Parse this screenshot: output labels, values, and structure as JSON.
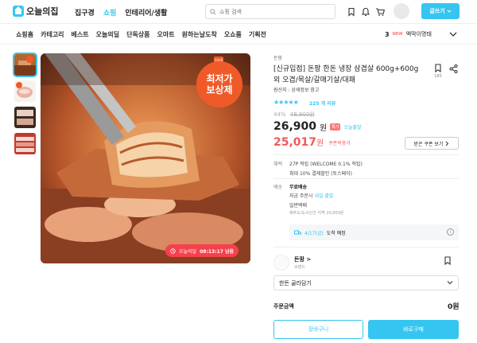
{
  "header": {
    "logo_text": "오늘의집",
    "nav": [
      "집구경",
      "쇼핑",
      "인테리어/생활"
    ],
    "search_placeholder": "쇼핑 검색",
    "write_label": "글쓰기"
  },
  "subnav": {
    "items": [
      "쇼핑홈",
      "카테고리",
      "베스트",
      "오늘의딜",
      "단독상품",
      "오마트",
      "원하는날도착",
      "오쇼룸",
      "기획전"
    ],
    "trend_rank": "3",
    "trend_new": "NEW",
    "trend_text": "액막이명태"
  },
  "hero": {
    "badge_line1": "최저가",
    "badge_line2": "보상제",
    "mini_tag": "오늘의딜",
    "timer_label": "오늘의딜",
    "timer_value": "08:13:17 남음"
  },
  "product": {
    "brand": "돈팡",
    "title": "[신규입점] 돈팡 한돈 냉장 삼겹살 600g+600g 외 오겹/목살/갈매기살/대패",
    "bookmark_count": "185",
    "origin": "원산지 : 상세정보 참고",
    "stars": "★★★★★",
    "review_count": "225 개 리뷰",
    "discount_pct": "44%",
    "original_price": "48,900원",
    "price": "26,900",
    "price_unit": "원",
    "special_badge": "특가",
    "best_price": "오늘출발",
    "coupon_price": "25,017",
    "coupon_unit": "원",
    "coupon_label": "쿠폰적용가",
    "coupon_button": "받은 쿠폰 보기"
  },
  "benefits": {
    "label": "혜택",
    "point": "27P 적립 (WELCOME 0.1% 적립)",
    "card": "최대 10% 결제할인 (토스페이)"
  },
  "shipping": {
    "label": "배송",
    "fee": "무료배송",
    "order_note_prefix": "지금 주문시",
    "order_note_hi": "내일 출발",
    "method": "일반택배",
    "extra": "제주도/도서산간 지역 20,000원",
    "arrival_date": "4/17(금)",
    "arrival_text": "도착 예정"
  },
  "brand_card": {
    "name": "돈팡 >",
    "sub": "브랜드"
  },
  "order": {
    "select_text": "한돈 골라담기",
    "total_label": "주문금액",
    "total_value": "0원",
    "cart_label": "장바구니",
    "buy_label": "바로구매"
  },
  "colors": {
    "accent": "#35c5f0",
    "coupon_red": "#f05a5a",
    "badge_orange": "#f05a29"
  }
}
